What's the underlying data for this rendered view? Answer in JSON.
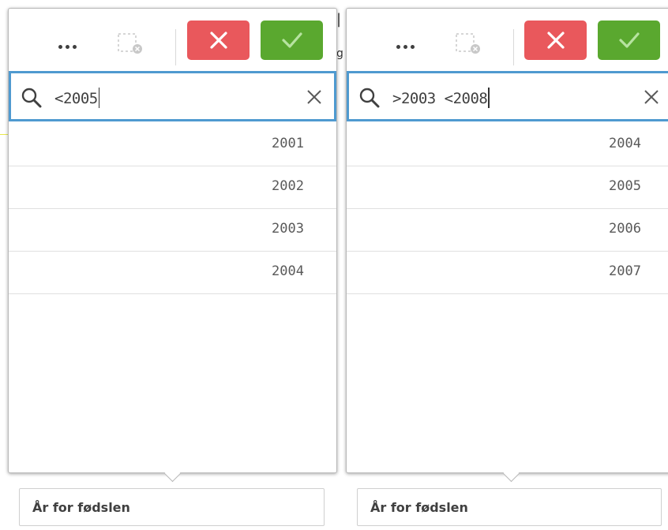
{
  "panels": [
    {
      "search": {
        "value": "<2005"
      },
      "items": [
        "2001",
        "2002",
        "2003",
        "2004"
      ],
      "field_label": "År for fødslen"
    },
    {
      "search": {
        "value": ">2003 <2008"
      },
      "items": [
        "2004",
        "2005",
        "2006",
        "2007"
      ],
      "field_label": "År for fødslen"
    }
  ],
  "colors": {
    "cancel": "#e9585c",
    "confirm": "#5aa82f",
    "search_border": "#4f9ad0"
  },
  "icons": {
    "more": "more-icon",
    "clear_selections": "clear-selections-icon",
    "cancel": "close-icon",
    "confirm": "check-icon",
    "search": "search-icon",
    "clear_search": "clear-search-icon"
  }
}
